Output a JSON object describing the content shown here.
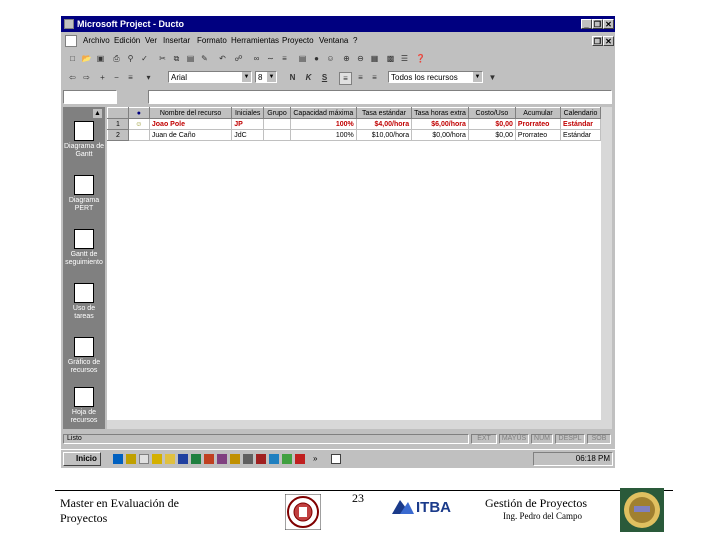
{
  "window": {
    "title": "Microsoft Project - Ducto",
    "minimize": "_",
    "restore": "❐",
    "close": "✕"
  },
  "menu": [
    "Archivo",
    "Edición",
    "Ver",
    "Insertar",
    "Formato",
    "Herramientas",
    "Proyecto",
    "Ventana",
    "?"
  ],
  "format_bar": {
    "font": "Arial",
    "size": "8",
    "bold": "N",
    "italic": "K",
    "underline": "S",
    "filter": "Todos los recursos"
  },
  "view_bar": [
    {
      "label": "Diagrama de Gantt"
    },
    {
      "label": "Diagrama PERT"
    },
    {
      "label": "Gantt de seguimiento"
    },
    {
      "label": "Uso de tareas"
    },
    {
      "label": "Gráfico de recursos"
    },
    {
      "label": "Hoja de recursos"
    }
  ],
  "table": {
    "columns": [
      "Nombre del recurso",
      "Iniciales",
      "Grupo",
      "Capacidad máxima",
      "Tasa estándar",
      "Tasa horas extra",
      "Costo/Uso",
      "Acumular",
      "Calendario"
    ],
    "rows": [
      {
        "num": "1",
        "indicator": "☺",
        "name": "Joao Pole",
        "initials": "JP",
        "group": "",
        "max_units": "100%",
        "std_rate": "$4,00/hora",
        "ovt_rate": "$6,00/hora",
        "cost_use": "$0,00",
        "accrue": "Prorrateo",
        "calendar": "Estándar"
      },
      {
        "num": "2",
        "indicator": "",
        "name": "Juan de Caño",
        "initials": "JdC",
        "group": "",
        "max_units": "100%",
        "std_rate": "$10,00/hora",
        "ovt_rate": "$0,00/hora",
        "cost_use": "$0,00",
        "accrue": "Prorrateo",
        "calendar": "Estándar"
      }
    ]
  },
  "status": {
    "left": "Listo",
    "indicators": [
      "EXT",
      "MAYÚS",
      "NUM",
      "DESPL",
      "SOB"
    ]
  },
  "taskbar": {
    "start": "Inicio",
    "clock": "06:18 PM"
  },
  "footer": {
    "left": "Master en Evaluación de Proyectos",
    "page": "23",
    "brand": "ITBA",
    "right_title": "Gestión de Proyectos",
    "author": "Ing. Pedro del Campo"
  }
}
